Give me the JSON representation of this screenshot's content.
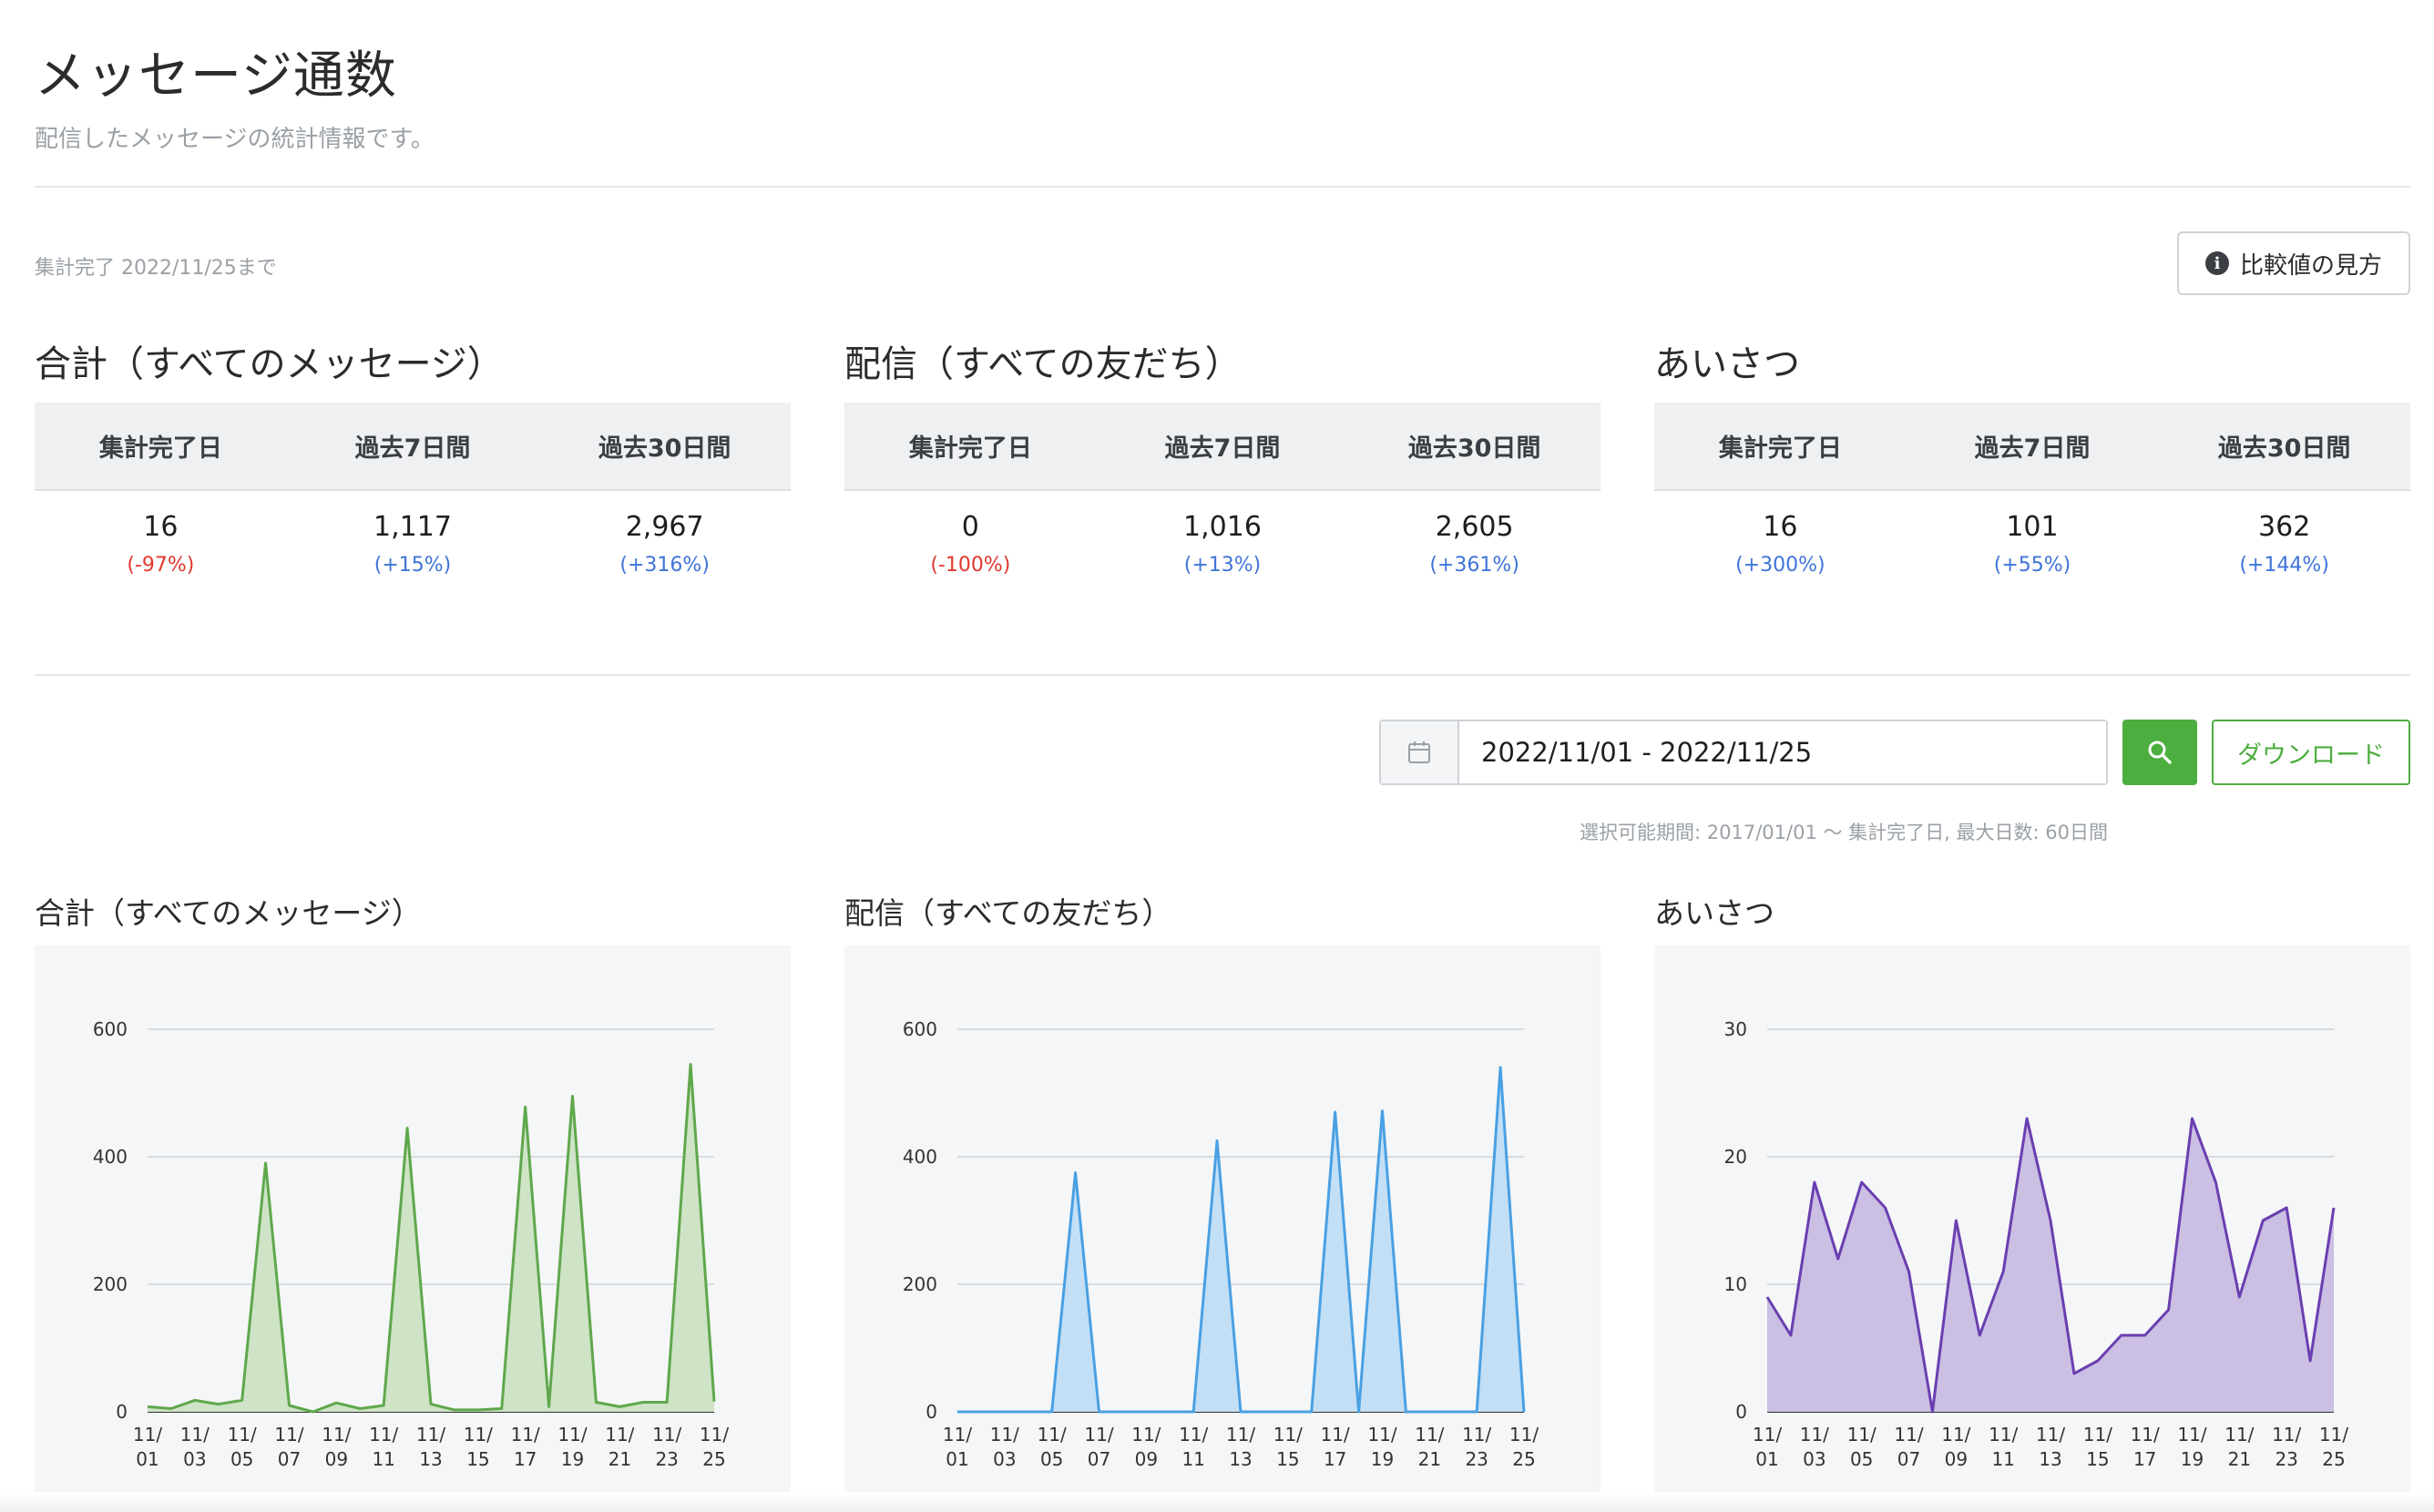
{
  "header": {
    "title": "メッセージ通数",
    "subtitle": "配信したメッセージの統計情報です。"
  },
  "summary": {
    "aggregated_note": "集計完了 2022/11/25まで",
    "compare_button_label": "比較値の見方",
    "compare_icon": "info-icon",
    "blocks": [
      {
        "title": "合計（すべてのメッセージ）",
        "columns": [
          "集計完了日",
          "過去7日間",
          "過去30日間"
        ],
        "values": [
          "16",
          "1,117",
          "2,967"
        ],
        "changes": [
          "(-97%)",
          "(+15%)",
          "(+316%)"
        ],
        "change_sign": [
          "neg",
          "pos",
          "pos"
        ]
      },
      {
        "title": "配信（すべての友だち）",
        "columns": [
          "集計完了日",
          "過去7日間",
          "過去30日間"
        ],
        "values": [
          "0",
          "1,016",
          "2,605"
        ],
        "changes": [
          "(-100%)",
          "(+13%)",
          "(+361%)"
        ],
        "change_sign": [
          "neg",
          "pos",
          "pos"
        ]
      },
      {
        "title": "あいさつ",
        "columns": [
          "集計完了日",
          "過去7日間",
          "過去30日間"
        ],
        "values": [
          "16",
          "101",
          "362"
        ],
        "changes": [
          "(+300%)",
          "(+55%)",
          "(+144%)"
        ],
        "change_sign": [
          "pos",
          "pos",
          "pos"
        ]
      }
    ]
  },
  "filters": {
    "date_range_value": "2022/11/01 - 2022/11/25",
    "calendar_icon": "calendar-icon",
    "search_icon": "search-icon",
    "download_label": "ダウンロード",
    "range_note": "選択可能期間: 2017/01/01 〜 集計完了日, 最大日数: 60日間"
  },
  "colors": {
    "positive": "#3f74d8",
    "negative": "#e0382f",
    "brand_green": "#4cae3e",
    "series_total": "#5fa84c",
    "series_broadcast": "#49a0e3",
    "series_greeting": "#6a3fb0"
  },
  "chart_data": [
    {
      "type": "area",
      "title": "合計（すべてのメッセージ）",
      "x": [
        "11/01",
        "11/02",
        "11/03",
        "11/04",
        "11/05",
        "11/06",
        "11/07",
        "11/08",
        "11/09",
        "11/10",
        "11/11",
        "11/12",
        "11/13",
        "11/14",
        "11/15",
        "11/16",
        "11/17",
        "11/18",
        "11/19",
        "11/20",
        "11/21",
        "11/22",
        "11/23",
        "11/24",
        "11/25"
      ],
      "tick_labels": [
        "11/\n01",
        "11/\n03",
        "11/\n05",
        "11/\n07",
        "11/\n09",
        "11/\n11",
        "11/\n13",
        "11/\n15",
        "11/\n17",
        "11/\n19",
        "11/\n21",
        "11/\n23",
        "11/\n25"
      ],
      "values": [
        8,
        5,
        18,
        12,
        18,
        390,
        10,
        0,
        14,
        5,
        10,
        445,
        12,
        3,
        3,
        5,
        478,
        8,
        495,
        15,
        8,
        15,
        15,
        545,
        16
      ],
      "ylim": [
        0,
        600
      ],
      "yticks": [
        0,
        200,
        400,
        600
      ],
      "grid": true,
      "color": "#5fa84c",
      "fill": "#cfe3c7"
    },
    {
      "type": "area",
      "title": "配信（すべての友だち）",
      "x": [
        "11/01",
        "11/02",
        "11/03",
        "11/04",
        "11/05",
        "11/06",
        "11/07",
        "11/08",
        "11/09",
        "11/10",
        "11/11",
        "11/12",
        "11/13",
        "11/14",
        "11/15",
        "11/16",
        "11/17",
        "11/18",
        "11/19",
        "11/20",
        "11/21",
        "11/22",
        "11/23",
        "11/24",
        "11/25"
      ],
      "tick_labels": [
        "11/\n01",
        "11/\n03",
        "11/\n05",
        "11/\n07",
        "11/\n09",
        "11/\n11",
        "11/\n13",
        "11/\n15",
        "11/\n17",
        "11/\n19",
        "11/\n21",
        "11/\n23",
        "11/\n25"
      ],
      "values": [
        0,
        0,
        0,
        0,
        0,
        375,
        0,
        0,
        0,
        0,
        0,
        425,
        0,
        0,
        0,
        0,
        470,
        0,
        472,
        0,
        0,
        0,
        0,
        540,
        0
      ],
      "ylim": [
        0,
        600
      ],
      "yticks": [
        0,
        200,
        400,
        600
      ],
      "grid": true,
      "color": "#49a0e3",
      "fill": "#c3dff5"
    },
    {
      "type": "area",
      "title": "あいさつ",
      "x": [
        "11/01",
        "11/02",
        "11/03",
        "11/04",
        "11/05",
        "11/06",
        "11/07",
        "11/08",
        "11/09",
        "11/10",
        "11/11",
        "11/12",
        "11/13",
        "11/14",
        "11/15",
        "11/16",
        "11/17",
        "11/18",
        "11/19",
        "11/20",
        "11/21",
        "11/22",
        "11/23",
        "11/24",
        "11/25"
      ],
      "tick_labels": [
        "11/\n01",
        "11/\n03",
        "11/\n05",
        "11/\n07",
        "11/\n09",
        "11/\n11",
        "11/\n13",
        "11/\n15",
        "11/\n17",
        "11/\n19",
        "11/\n21",
        "11/\n23",
        "11/\n25"
      ],
      "values": [
        9,
        6,
        18,
        12,
        18,
        16,
        11,
        0,
        15,
        6,
        11,
        23,
        15,
        3,
        4,
        6,
        6,
        8,
        23,
        18,
        9,
        15,
        16,
        4,
        16
      ],
      "ylim": [
        0,
        30
      ],
      "yticks": [
        0,
        10,
        20,
        30
      ],
      "grid": true,
      "color": "#6a3fb0",
      "fill": "#cbbfe3"
    }
  ]
}
